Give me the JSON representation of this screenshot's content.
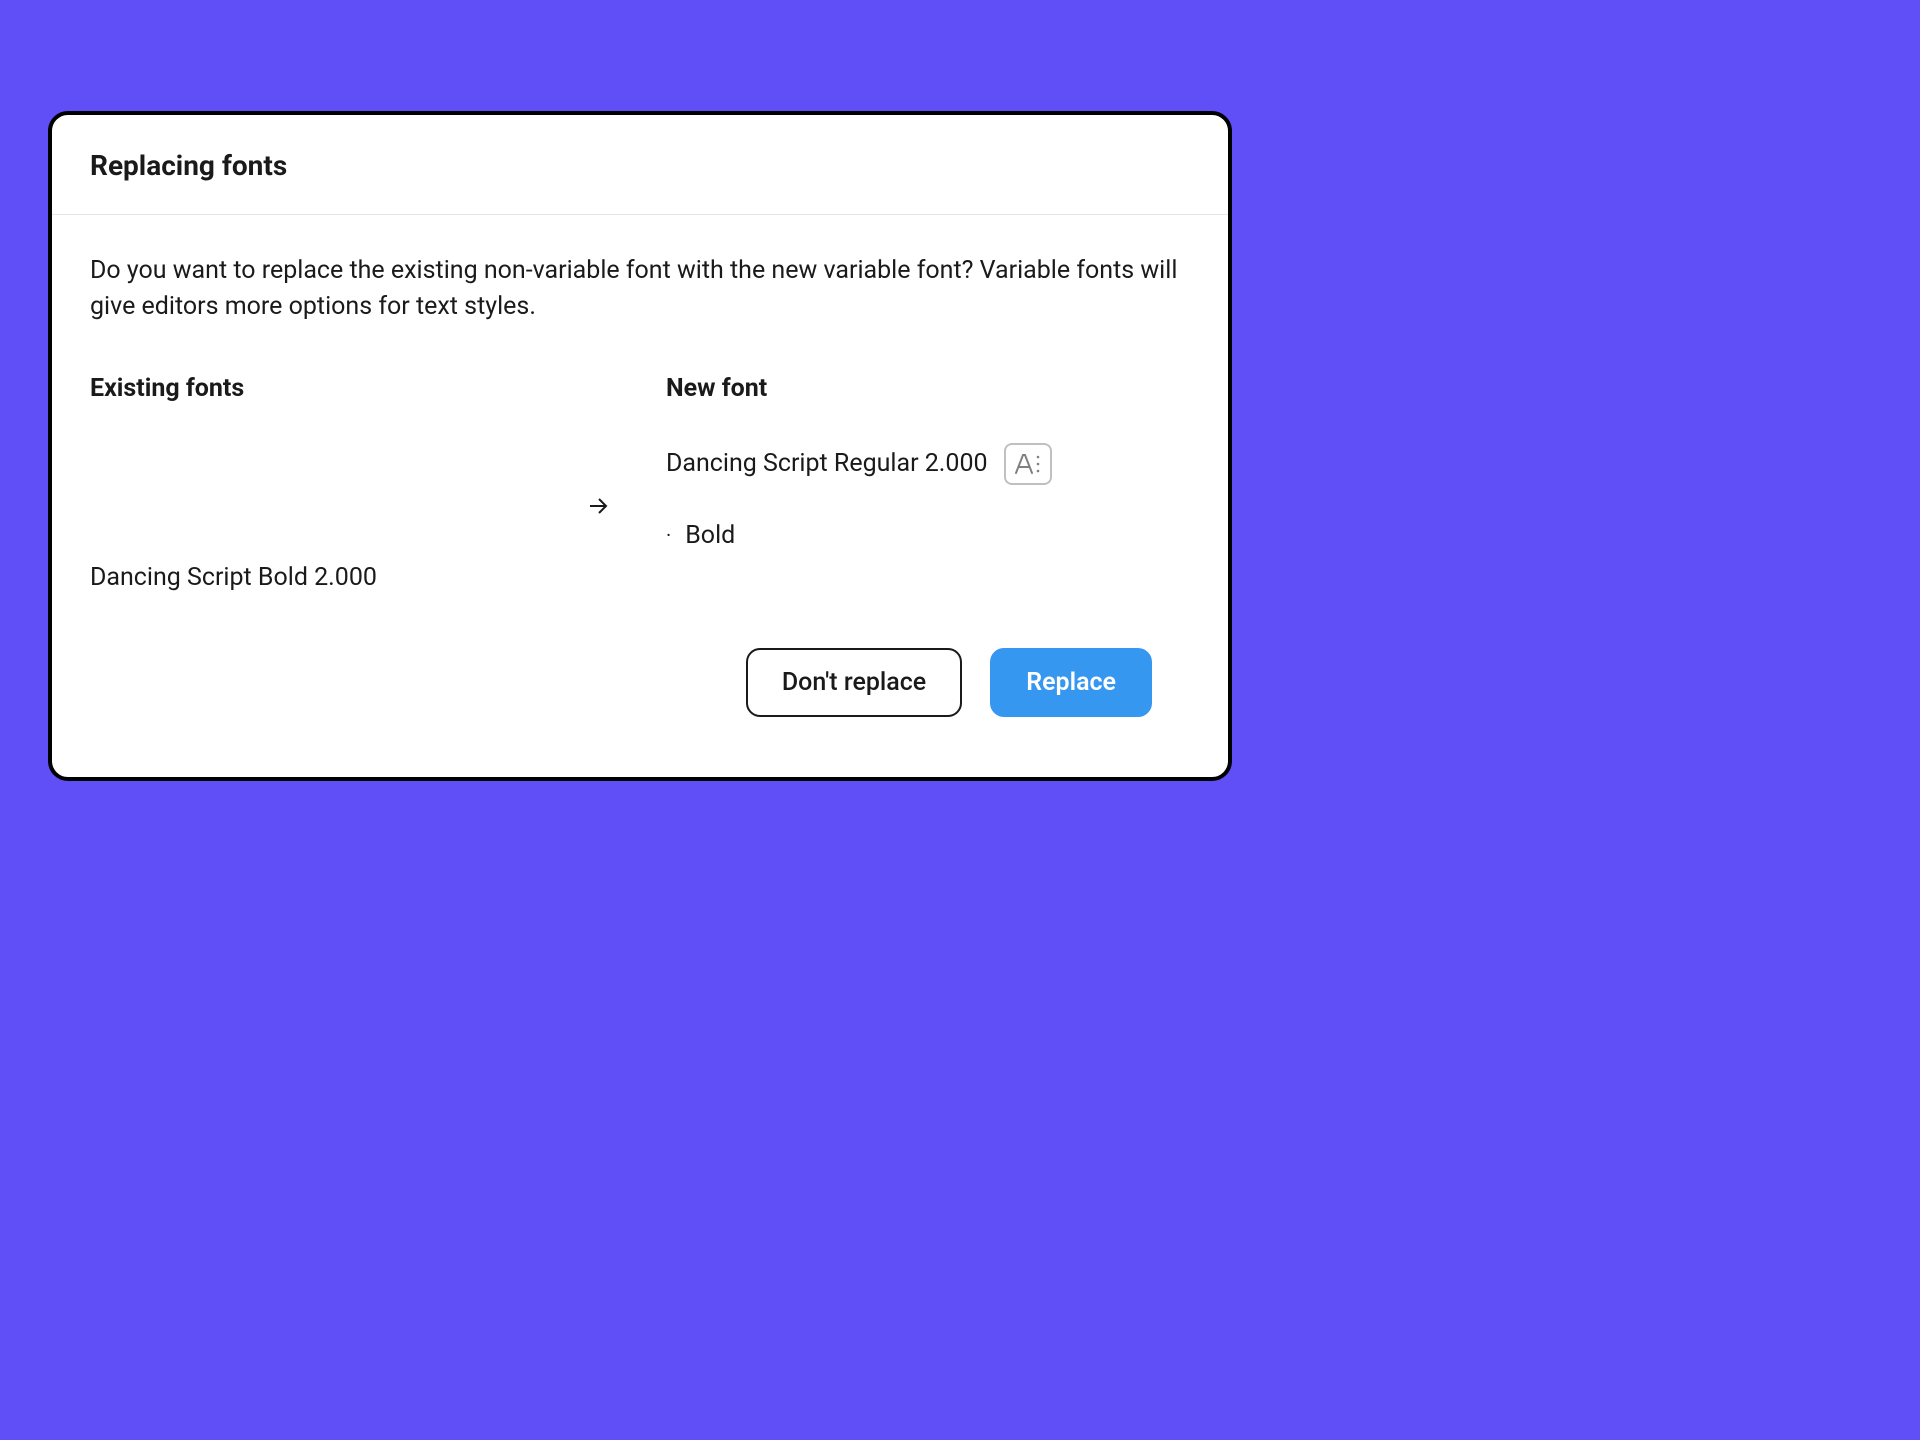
{
  "dialog": {
    "title": "Replacing fonts",
    "description": "Do you want to replace the existing non-variable font with the new variable font? Variable fonts will give editors more options for text styles.",
    "existing_header": "Existing fonts",
    "new_header": "New font",
    "existing_font": "Dancing Script Bold 2.000",
    "new_font": "Dancing Script Regular 2.000",
    "new_font_style": "Bold",
    "buttons": {
      "cancel": "Don't replace",
      "confirm": "Replace"
    }
  }
}
